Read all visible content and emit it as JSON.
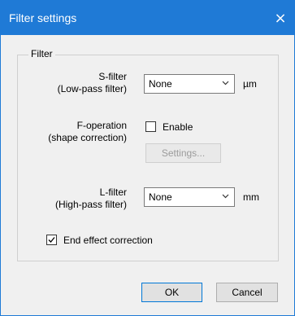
{
  "dialog": {
    "title": "Filter settings",
    "close_glyph": "×",
    "group_label": "Filter"
  },
  "s_filter": {
    "label_line1": "S-filter",
    "label_line2": "(Low-pass filter)",
    "value": "None",
    "unit": "µm"
  },
  "f_operation": {
    "label_line1": "F-operation",
    "label_line2": "(shape correction)",
    "enable_label": "Enable",
    "enable_checked": false,
    "settings_label": "Settings..."
  },
  "l_filter": {
    "label_line1": "L-filter",
    "label_line2": "(High-pass filter)",
    "value": "None",
    "unit": "mm"
  },
  "end_effect": {
    "label": "End effect correction",
    "checked": true
  },
  "buttons": {
    "ok_label": "OK",
    "cancel_label": "Cancel"
  },
  "colors": {
    "titlebar": "#1f7ad6",
    "background": "#f0f0f0"
  },
  "icons": [
    "close-icon",
    "chevron-down-icon",
    "checkmark-icon"
  ]
}
